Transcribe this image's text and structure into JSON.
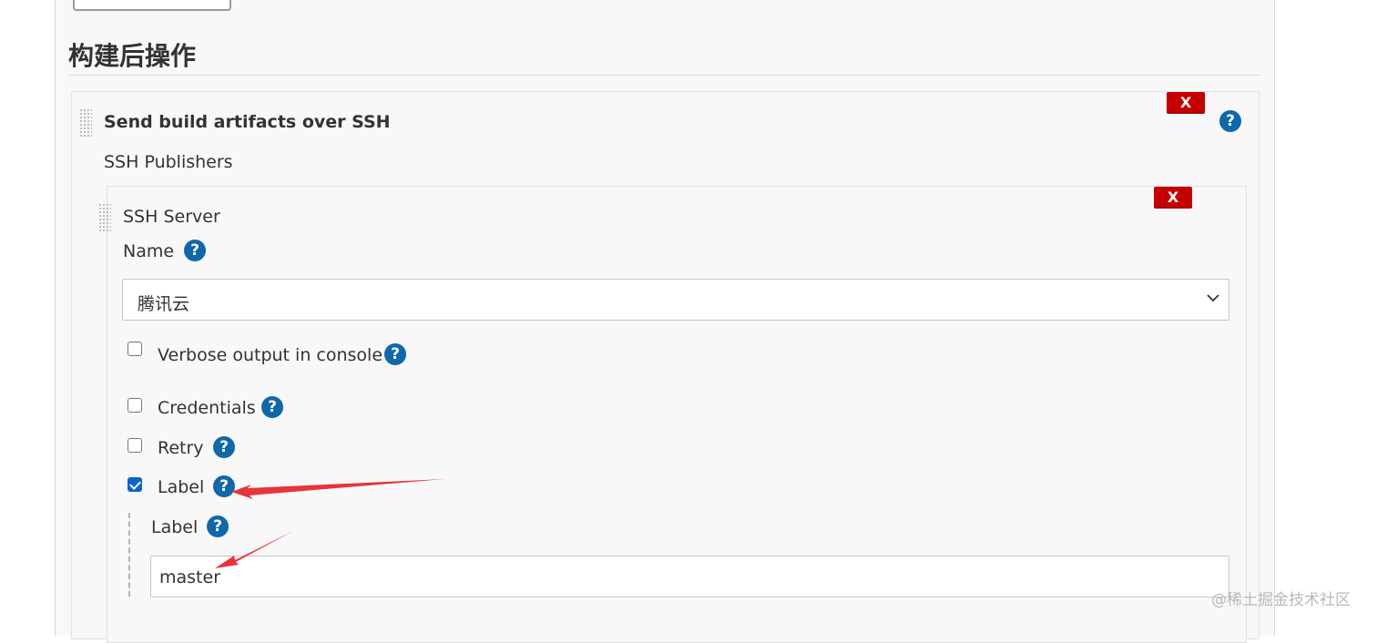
{
  "section": {
    "title": "构建后操作"
  },
  "plugin": {
    "title": "Send build artifacts over SSH",
    "delete_label": "X",
    "help_glyph": "?",
    "publishers_label": "SSH Publishers"
  },
  "server": {
    "label": "SSH Server",
    "delete_label": "X",
    "name_label": "Name",
    "name_value": "腾讯云",
    "options": [
      {
        "label": "Verbose output in console",
        "checked": false
      },
      {
        "label": "Credentials",
        "checked": false
      },
      {
        "label": "Retry",
        "checked": false
      },
      {
        "label": "Label",
        "checked": true
      }
    ],
    "label_field": {
      "label": "Label",
      "value": "master"
    }
  },
  "colors": {
    "delete": "#c50000",
    "help": "#0f68a9",
    "checkbox": "#0a63d3",
    "annotation": "#e8333a"
  },
  "icons": [
    "drag-handle-icon",
    "help-icon",
    "chevron-down-icon",
    "annotation-arrow"
  ],
  "watermark": "@稀土掘金技术社区"
}
